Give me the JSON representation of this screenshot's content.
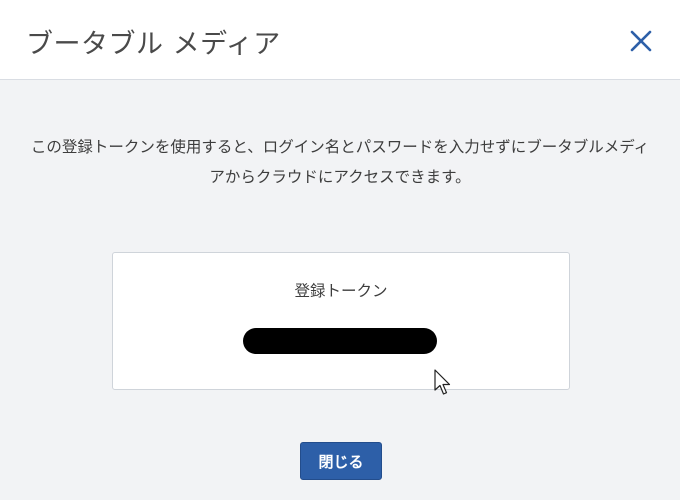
{
  "dialog": {
    "title": "ブータブル メディア",
    "close_icon": "close-icon",
    "description": "この登録トークンを使用すると、ログイン名とパスワードを入力せずにブータブルメディアからクラウドにアクセスできます。",
    "token": {
      "label": "登録トークン",
      "value_state": "redacted"
    },
    "close_button_label": "閉じる"
  },
  "colors": {
    "header_bg": "#ffffff",
    "body_bg": "#f2f3f5",
    "accent": "#2d5fa8",
    "close_icon": "#2d5fa8"
  }
}
